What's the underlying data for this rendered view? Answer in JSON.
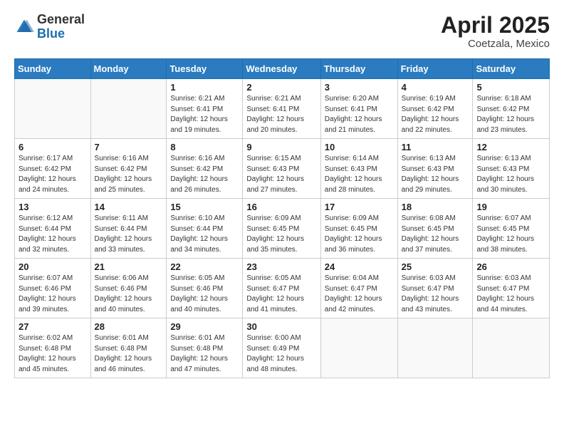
{
  "logo": {
    "general": "General",
    "blue": "Blue"
  },
  "title": {
    "month": "April 2025",
    "location": "Coetzala, Mexico"
  },
  "weekdays": [
    "Sunday",
    "Monday",
    "Tuesday",
    "Wednesday",
    "Thursday",
    "Friday",
    "Saturday"
  ],
  "weeks": [
    [
      {
        "day": "",
        "detail": ""
      },
      {
        "day": "",
        "detail": ""
      },
      {
        "day": "1",
        "detail": "Sunrise: 6:21 AM\nSunset: 6:41 PM\nDaylight: 12 hours\nand 19 minutes."
      },
      {
        "day": "2",
        "detail": "Sunrise: 6:21 AM\nSunset: 6:41 PM\nDaylight: 12 hours\nand 20 minutes."
      },
      {
        "day": "3",
        "detail": "Sunrise: 6:20 AM\nSunset: 6:41 PM\nDaylight: 12 hours\nand 21 minutes."
      },
      {
        "day": "4",
        "detail": "Sunrise: 6:19 AM\nSunset: 6:42 PM\nDaylight: 12 hours\nand 22 minutes."
      },
      {
        "day": "5",
        "detail": "Sunrise: 6:18 AM\nSunset: 6:42 PM\nDaylight: 12 hours\nand 23 minutes."
      }
    ],
    [
      {
        "day": "6",
        "detail": "Sunrise: 6:17 AM\nSunset: 6:42 PM\nDaylight: 12 hours\nand 24 minutes."
      },
      {
        "day": "7",
        "detail": "Sunrise: 6:16 AM\nSunset: 6:42 PM\nDaylight: 12 hours\nand 25 minutes."
      },
      {
        "day": "8",
        "detail": "Sunrise: 6:16 AM\nSunset: 6:42 PM\nDaylight: 12 hours\nand 26 minutes."
      },
      {
        "day": "9",
        "detail": "Sunrise: 6:15 AM\nSunset: 6:43 PM\nDaylight: 12 hours\nand 27 minutes."
      },
      {
        "day": "10",
        "detail": "Sunrise: 6:14 AM\nSunset: 6:43 PM\nDaylight: 12 hours\nand 28 minutes."
      },
      {
        "day": "11",
        "detail": "Sunrise: 6:13 AM\nSunset: 6:43 PM\nDaylight: 12 hours\nand 29 minutes."
      },
      {
        "day": "12",
        "detail": "Sunrise: 6:13 AM\nSunset: 6:43 PM\nDaylight: 12 hours\nand 30 minutes."
      }
    ],
    [
      {
        "day": "13",
        "detail": "Sunrise: 6:12 AM\nSunset: 6:44 PM\nDaylight: 12 hours\nand 32 minutes."
      },
      {
        "day": "14",
        "detail": "Sunrise: 6:11 AM\nSunset: 6:44 PM\nDaylight: 12 hours\nand 33 minutes."
      },
      {
        "day": "15",
        "detail": "Sunrise: 6:10 AM\nSunset: 6:44 PM\nDaylight: 12 hours\nand 34 minutes."
      },
      {
        "day": "16",
        "detail": "Sunrise: 6:09 AM\nSunset: 6:45 PM\nDaylight: 12 hours\nand 35 minutes."
      },
      {
        "day": "17",
        "detail": "Sunrise: 6:09 AM\nSunset: 6:45 PM\nDaylight: 12 hours\nand 36 minutes."
      },
      {
        "day": "18",
        "detail": "Sunrise: 6:08 AM\nSunset: 6:45 PM\nDaylight: 12 hours\nand 37 minutes."
      },
      {
        "day": "19",
        "detail": "Sunrise: 6:07 AM\nSunset: 6:45 PM\nDaylight: 12 hours\nand 38 minutes."
      }
    ],
    [
      {
        "day": "20",
        "detail": "Sunrise: 6:07 AM\nSunset: 6:46 PM\nDaylight: 12 hours\nand 39 minutes."
      },
      {
        "day": "21",
        "detail": "Sunrise: 6:06 AM\nSunset: 6:46 PM\nDaylight: 12 hours\nand 40 minutes."
      },
      {
        "day": "22",
        "detail": "Sunrise: 6:05 AM\nSunset: 6:46 PM\nDaylight: 12 hours\nand 40 minutes."
      },
      {
        "day": "23",
        "detail": "Sunrise: 6:05 AM\nSunset: 6:47 PM\nDaylight: 12 hours\nand 41 minutes."
      },
      {
        "day": "24",
        "detail": "Sunrise: 6:04 AM\nSunset: 6:47 PM\nDaylight: 12 hours\nand 42 minutes."
      },
      {
        "day": "25",
        "detail": "Sunrise: 6:03 AM\nSunset: 6:47 PM\nDaylight: 12 hours\nand 43 minutes."
      },
      {
        "day": "26",
        "detail": "Sunrise: 6:03 AM\nSunset: 6:47 PM\nDaylight: 12 hours\nand 44 minutes."
      }
    ],
    [
      {
        "day": "27",
        "detail": "Sunrise: 6:02 AM\nSunset: 6:48 PM\nDaylight: 12 hours\nand 45 minutes."
      },
      {
        "day": "28",
        "detail": "Sunrise: 6:01 AM\nSunset: 6:48 PM\nDaylight: 12 hours\nand 46 minutes."
      },
      {
        "day": "29",
        "detail": "Sunrise: 6:01 AM\nSunset: 6:48 PM\nDaylight: 12 hours\nand 47 minutes."
      },
      {
        "day": "30",
        "detail": "Sunrise: 6:00 AM\nSunset: 6:49 PM\nDaylight: 12 hours\nand 48 minutes."
      },
      {
        "day": "",
        "detail": ""
      },
      {
        "day": "",
        "detail": ""
      },
      {
        "day": "",
        "detail": ""
      }
    ]
  ]
}
